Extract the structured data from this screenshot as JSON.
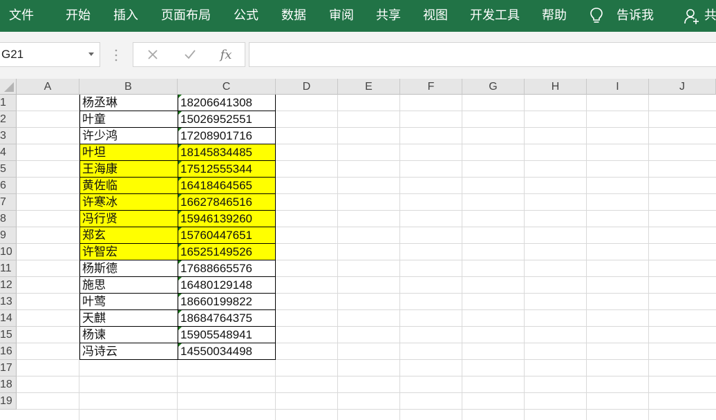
{
  "ribbon": {
    "tabs": [
      "文件",
      "开始",
      "插入",
      "页面布局",
      "公式",
      "数据",
      "审阅",
      "共享",
      "视图",
      "开发工具",
      "帮助"
    ],
    "tell_me": "告诉我",
    "share": "共"
  },
  "formula_bar": {
    "name_box": "G21",
    "formula": ""
  },
  "sheet": {
    "columns": [
      "A",
      "B",
      "C",
      "D",
      "E",
      "F",
      "G",
      "H",
      "I",
      "J"
    ],
    "row_numbers": [
      "1",
      "2",
      "3",
      "4",
      "5",
      "6",
      "7",
      "8",
      "9",
      "10",
      "11",
      "12",
      "13",
      "14",
      "15",
      "16",
      "17",
      "18",
      "19"
    ],
    "highlight_color": "#ffff00",
    "rows": [
      {
        "name": "杨丞琳",
        "phone": "18206641308",
        "highlight": false
      },
      {
        "name": "叶童",
        "phone": "15026952551",
        "highlight": false
      },
      {
        "name": "许少鸿",
        "phone": "17208901716",
        "highlight": false
      },
      {
        "name": "叶坦",
        "phone": "18145834485",
        "highlight": true
      },
      {
        "name": "王海康",
        "phone": "17512555344",
        "highlight": true
      },
      {
        "name": "黄佐临",
        "phone": "16418464565",
        "highlight": true
      },
      {
        "name": "许寒冰",
        "phone": "16627846516",
        "highlight": true
      },
      {
        "name": "冯行贤",
        "phone": "15946139260",
        "highlight": true
      },
      {
        "name": "郑玄",
        "phone": "15760447651",
        "highlight": true
      },
      {
        "name": "许智宏",
        "phone": "16525149526",
        "highlight": true
      },
      {
        "name": "杨斯德",
        "phone": "17688665576",
        "highlight": false
      },
      {
        "name": "施思",
        "phone": "16480129148",
        "highlight": false
      },
      {
        "name": "叶莺",
        "phone": "18660199822",
        "highlight": false
      },
      {
        "name": "天麒",
        "phone": "18684764375",
        "highlight": false
      },
      {
        "name": "杨谏",
        "phone": "15905548941",
        "highlight": false
      },
      {
        "name": "冯诗云",
        "phone": "14550034498",
        "highlight": false
      }
    ]
  }
}
